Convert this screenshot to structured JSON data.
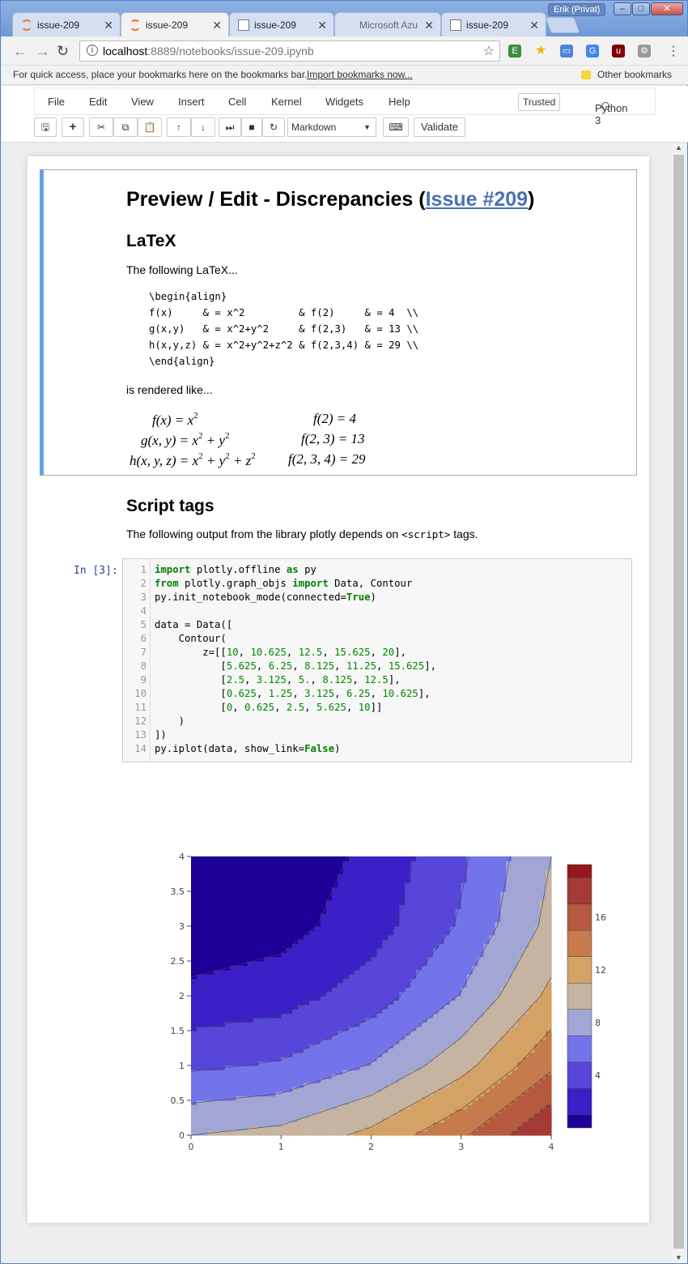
{
  "browser": {
    "user": "Erik (Privat)",
    "tabs": [
      {
        "title": "issue-209",
        "icon": "jupyter-icon"
      },
      {
        "title": "issue-209",
        "icon": "jupyter-icon"
      },
      {
        "title": "issue-209",
        "icon": "document-icon"
      },
      {
        "title": "Microsoft Azu",
        "icon": "microsoft-icon"
      },
      {
        "title": "issue-209",
        "icon": "document-icon"
      }
    ],
    "url_host": "localhost",
    "url_path": ":8889/notebooks/issue-209.ipynb",
    "bookmarks_text": "For quick access, place your bookmarks here on the bookmarks bar.",
    "bookmarks_link": "Import bookmarks now...",
    "other_bookmarks": "Other bookmarks"
  },
  "jupyter": {
    "menu": [
      "File",
      "Edit",
      "View",
      "Insert",
      "Cell",
      "Kernel",
      "Widgets",
      "Help"
    ],
    "trusted": "Trusted",
    "kernel": "Python 3",
    "cell_type": "Markdown",
    "validate": "Validate"
  },
  "markdown": {
    "h1_prefix": "Preview / Edit - Discrepancies (",
    "h1_link": "Issue #209",
    "h1_suffix": ")",
    "h2_latex": "LaTeX",
    "p_following": "The following LaTeX...",
    "latex_code": "\\begin{align}\nf(x)     & = x^2         & f(2)     & = 4  \\\\\ng(x,y)   & = x^2+y^2     & f(2,3)   & = 13 \\\\\nh(x,y,z) & = x^2+y^2+z^2 & f(2,3,4) & = 29 \\\\\n\\end{align}",
    "p_rendered": "is rendered like...",
    "math": {
      "r1l_a": "f(x) = x",
      "r1l_b": "2",
      "r1r": "f(2) = 4",
      "r2l_a": "g(x, y) = x",
      "r2l_b": "2",
      "r2l_c": " + y",
      "r2l_d": "2",
      "r2r": "f(2, 3) = 13",
      "r3l_a": "h(x, y, z) = x",
      "r3l_b": "2",
      "r3l_c": " + y",
      "r3l_d": "2",
      "r3l_e": " + z",
      "r3l_f": "2",
      "r3r": "f(2, 3, 4) = 29"
    },
    "h2_script": "Script tags",
    "p_script_a": "The following output from the library plotly depends on ",
    "p_script_code": "<script>",
    "p_script_b": " tags."
  },
  "code_cell": {
    "prompt": "In [3]:",
    "lines": [
      [
        [
          "kw",
          "import"
        ],
        [
          "t",
          " plotly.offline "
        ],
        [
          "kw",
          "as"
        ],
        [
          "t",
          " py"
        ]
      ],
      [
        [
          "kw",
          "from"
        ],
        [
          "t",
          " plotly.graph_objs "
        ],
        [
          "kw",
          "import"
        ],
        [
          "t",
          " Data, Contour"
        ]
      ],
      [
        [
          "t",
          "py.init_notebook_mode(connected="
        ],
        [
          "kw",
          "True"
        ],
        [
          "t",
          ")"
        ]
      ],
      [
        [
          "t",
          ""
        ]
      ],
      [
        [
          "t",
          "data = Data(["
        ]
      ],
      [
        [
          "t",
          "    Contour("
        ]
      ],
      [
        [
          "t",
          "        z=[["
        ],
        [
          "n",
          "10"
        ],
        [
          "t",
          ", "
        ],
        [
          "n",
          "10.625"
        ],
        [
          "t",
          ", "
        ],
        [
          "n",
          "12.5"
        ],
        [
          "t",
          ", "
        ],
        [
          "n",
          "15.625"
        ],
        [
          "t",
          ", "
        ],
        [
          "n",
          "20"
        ],
        [
          "t",
          "],"
        ]
      ],
      [
        [
          "t",
          "           ["
        ],
        [
          "n",
          "5.625"
        ],
        [
          "t",
          ", "
        ],
        [
          "n",
          "6.25"
        ],
        [
          "t",
          ", "
        ],
        [
          "n",
          "8.125"
        ],
        [
          "t",
          ", "
        ],
        [
          "n",
          "11.25"
        ],
        [
          "t",
          ", "
        ],
        [
          "n",
          "15.625"
        ],
        [
          "t",
          "],"
        ]
      ],
      [
        [
          "t",
          "           ["
        ],
        [
          "n",
          "2.5"
        ],
        [
          "t",
          ", "
        ],
        [
          "n",
          "3.125"
        ],
        [
          "t",
          ", "
        ],
        [
          "n",
          "5."
        ],
        [
          "t",
          ", "
        ],
        [
          "n",
          "8.125"
        ],
        [
          "t",
          ", "
        ],
        [
          "n",
          "12.5"
        ],
        [
          "t",
          "],"
        ]
      ],
      [
        [
          "t",
          "           ["
        ],
        [
          "n",
          "0.625"
        ],
        [
          "t",
          ", "
        ],
        [
          "n",
          "1.25"
        ],
        [
          "t",
          ", "
        ],
        [
          "n",
          "3.125"
        ],
        [
          "t",
          ", "
        ],
        [
          "n",
          "6.25"
        ],
        [
          "t",
          ", "
        ],
        [
          "n",
          "10.625"
        ],
        [
          "t",
          "],"
        ]
      ],
      [
        [
          "t",
          "           ["
        ],
        [
          "n",
          "0"
        ],
        [
          "t",
          ", "
        ],
        [
          "n",
          "0.625"
        ],
        [
          "t",
          ", "
        ],
        [
          "n",
          "2.5"
        ],
        [
          "t",
          ", "
        ],
        [
          "n",
          "5.625"
        ],
        [
          "t",
          ", "
        ],
        [
          "n",
          "10"
        ],
        [
          "t",
          "]]"
        ]
      ],
      [
        [
          "t",
          "    )"
        ]
      ],
      [
        [
          "t",
          "])"
        ]
      ],
      [
        [
          "t",
          "py.iplot(data, show_link="
        ],
        [
          "kw",
          "False"
        ],
        [
          "t",
          ")"
        ]
      ]
    ]
  },
  "chart_data": {
    "type": "heatmap",
    "subtype": "contour",
    "x": [
      0,
      1,
      2,
      3,
      4
    ],
    "y": [
      0,
      1,
      2,
      3,
      4
    ],
    "z": [
      [
        10,
        10.625,
        12.5,
        15.625,
        20
      ],
      [
        5.625,
        6.25,
        8.125,
        11.25,
        15.625
      ],
      [
        2.5,
        3.125,
        5.0,
        8.125,
        12.5
      ],
      [
        0.625,
        1.25,
        3.125,
        6.25,
        10.625
      ],
      [
        0,
        0.625,
        2.5,
        5.625,
        10
      ]
    ],
    "xticks": [
      "0",
      "1",
      "2",
      "3",
      "4"
    ],
    "yticks": [
      "0",
      "0.5",
      "1",
      "1.5",
      "2",
      "2.5",
      "3",
      "3.5",
      "4"
    ],
    "xrange": [
      0,
      4
    ],
    "yrange": [
      0,
      4
    ],
    "colorbar_ticks": [
      "4",
      "8",
      "12",
      "16"
    ],
    "contour_levels": [
      0,
      2,
      4,
      6,
      8,
      10,
      12,
      14,
      16,
      18,
      20
    ],
    "colors": [
      "#1f0098",
      "#3a20c6",
      "#5746d9",
      "#7474ea",
      "#a1a6d4",
      "#c6b3a0",
      "#d5a265",
      "#c57b4b",
      "#b55a3e",
      "#a43a33",
      "#93181e"
    ]
  }
}
